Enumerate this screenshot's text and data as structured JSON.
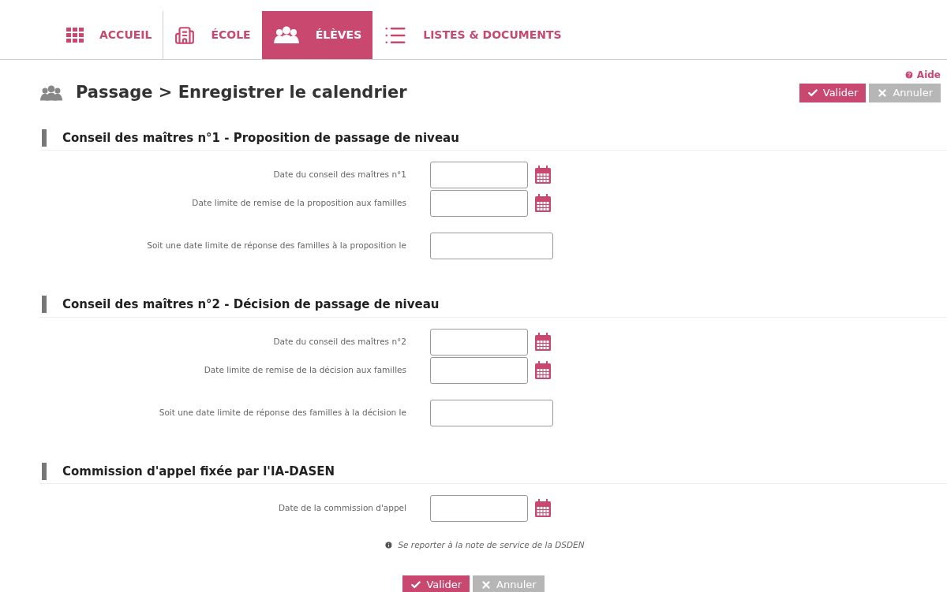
{
  "nav": [
    {
      "label": "ACCUEIL",
      "selected": false
    },
    {
      "label": "ÉCOLE",
      "selected": false
    },
    {
      "label": "ÉLÈVES",
      "selected": true
    },
    {
      "label": "LISTES & DOCUMENTS",
      "selected": false
    }
  ],
  "help": "Aide",
  "title": "Passage > Enregistrer le calendrier",
  "top_buttons": [
    {
      "label": "Valider",
      "kind": "primary"
    },
    {
      "label": "Annuler",
      "kind": "secondary"
    }
  ],
  "sections": [
    {
      "heading": "Conseil des maîtres n°1 - Proposition de passage de niveau",
      "fields": [
        {
          "label": "Date du conseil des maîtres n°1",
          "kind": "date"
        },
        {
          "label": "Date limite de remise de la proposition aux familles",
          "kind": "date"
        },
        {
          "label": "Soit une date limite de réponse des familles à la proposition le",
          "kind": "text"
        }
      ]
    },
    {
      "heading": "Conseil des maîtres n°2 - Décision de passage de niveau",
      "fields": [
        {
          "label": "Date du conseil des maîtres n°2",
          "kind": "date"
        },
        {
          "label": "Date limite de remise de la décision aux familles",
          "kind": "date"
        },
        {
          "label": "Soit une date limite de réponse des familles à la décision le",
          "kind": "text"
        }
      ]
    },
    {
      "heading": "Commission d'appel fixée par l'IA-DASEN",
      "fields": [
        {
          "label": "Date de la commission d'appel",
          "kind": "date"
        }
      ]
    }
  ],
  "note": "Se reporter à la note de service de la DSDEN",
  "bottom_buttons": [
    {
      "label": "Valider",
      "kind": "primary"
    },
    {
      "label": "Annuler",
      "kind": "secondary"
    }
  ]
}
